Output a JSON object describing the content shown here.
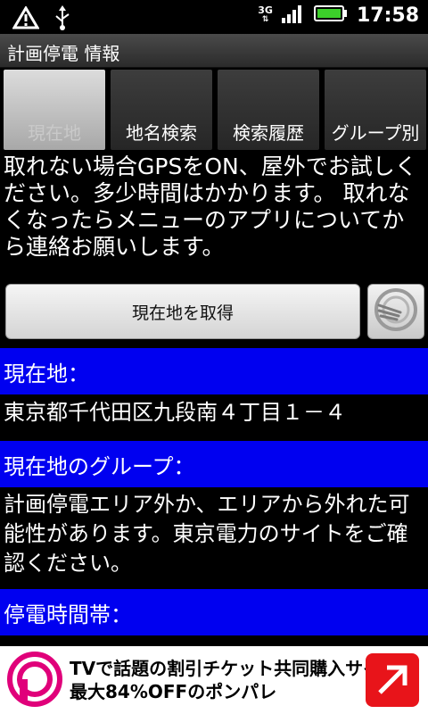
{
  "status_bar": {
    "network": "3G",
    "time": "17:58",
    "icons": [
      "warning-icon",
      "usb-icon",
      "signal-icon",
      "battery-icon"
    ]
  },
  "app": {
    "title": "計画停電 情報"
  },
  "tabs": [
    {
      "label": "現在地",
      "selected": true
    },
    {
      "label": "地名検索",
      "selected": false
    },
    {
      "label": "検索履歴",
      "selected": false
    },
    {
      "label": "グループ別",
      "selected": false
    }
  ],
  "info_text": "取れない場合GPSをON、屋外でお試しください。多少時間はかかります。 取れなくなったらメニューのアプリについてから連絡お願いします。",
  "get_location_button": "現在地を取得",
  "sections": {
    "location_header": "現在地：",
    "location_value": "東京都千代田区九段南４丁目１－４",
    "group_header": "現在地のグループ：",
    "group_value": "計画停電エリア外か、エリアから外れた可能性があります。東京電力のサイトをご確認ください。",
    "time_header": "停電時間帯："
  },
  "ad": {
    "line1": "TVで話題の割引チケット共同購入サイト",
    "line2": "最大84%OFFのポンパレ"
  },
  "colors": {
    "section_header": "#0000f0",
    "background": "#000000"
  }
}
